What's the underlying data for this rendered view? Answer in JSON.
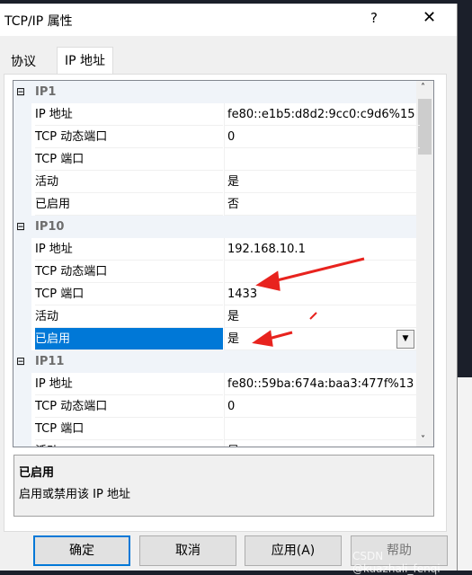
{
  "dialog": {
    "title": "TCP/IP 属性",
    "help": "?",
    "close": "✕"
  },
  "tabs": [
    "协议",
    "IP 地址"
  ],
  "groups": [
    {
      "name": "IP1",
      "rows": [
        [
          "IP 地址",
          "fe80::e1b5:d8d2:9cc0:c9d6%15"
        ],
        [
          "TCP 动态端口",
          "0"
        ],
        [
          "TCP 端口",
          ""
        ],
        [
          "活动",
          "是"
        ],
        [
          "已启用",
          "否"
        ]
      ]
    },
    {
      "name": "IP10",
      "rows": [
        [
          "IP 地址",
          "192.168.10.1"
        ],
        [
          "TCP 动态端口",
          ""
        ],
        [
          "TCP 端口",
          "1433"
        ],
        [
          "活动",
          "是"
        ],
        [
          "已启用",
          "是"
        ]
      ]
    },
    {
      "name": "IP11",
      "rows": [
        [
          "IP 地址",
          "fe80::59ba:674a:baa3:477f%13"
        ],
        [
          "TCP 动态端口",
          "0"
        ],
        [
          "TCP 端口",
          ""
        ],
        [
          "活动",
          "是"
        ]
      ]
    }
  ],
  "collapse_glyph": "⊟",
  "description": {
    "title": "已启用",
    "text": "启用或禁用该 IP 地址"
  },
  "buttons": {
    "ok": "确定",
    "cancel": "取消",
    "apply": "应用(A)",
    "help": "帮助"
  },
  "watermark": "CSDN @kuazhali_fenqi",
  "annotation_color": "#e8231e",
  "selection_color": "#0078d7"
}
